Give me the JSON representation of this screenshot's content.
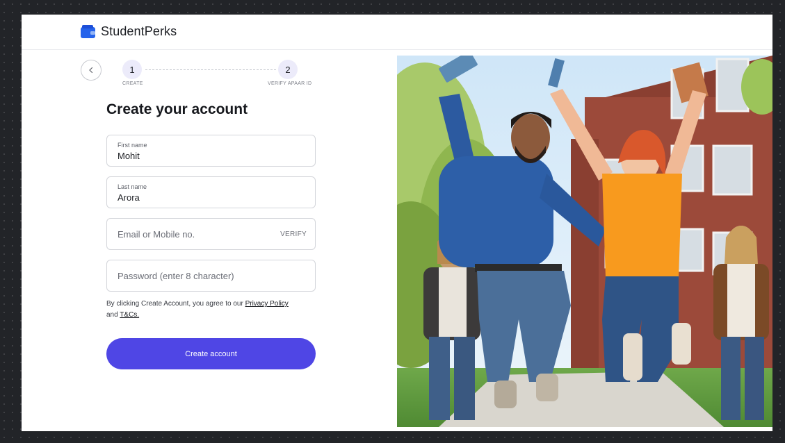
{
  "brand": {
    "name": "StudentPerks",
    "icon": "wallet-icon",
    "accent": "#2563eb"
  },
  "stepper": {
    "back_icon": "chevron-left-icon",
    "steps": [
      {
        "number": "1",
        "label": "CREATE"
      },
      {
        "number": "2",
        "label": "VERIFY APAAR ID"
      }
    ]
  },
  "form": {
    "title": "Create your account",
    "first_name": {
      "label": "First name",
      "value": "Mohit"
    },
    "last_name": {
      "label": "Last name",
      "value": "Arora"
    },
    "email": {
      "placeholder": "Email or Mobile no.",
      "action": "VERIFY"
    },
    "password": {
      "placeholder": "Password (enter 8 character)"
    },
    "terms": {
      "prefix": "By clicking Create Account, you agree to our",
      "privacy": "Privacy Policy",
      "and": "and",
      "tcs": "T&Cs."
    },
    "submit": {
      "label": "Create account",
      "color": "#4f46e5"
    }
  }
}
